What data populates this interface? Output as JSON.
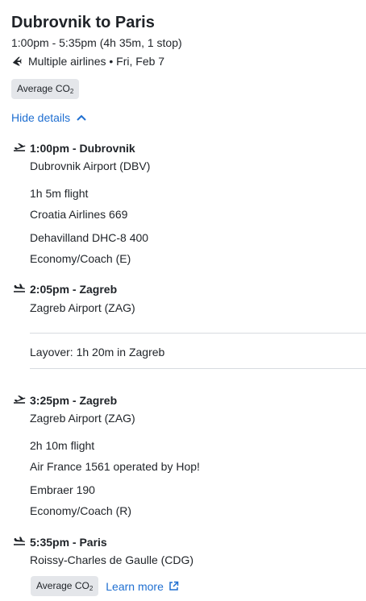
{
  "header": {
    "title": "Dubrovnik to Paris",
    "times": "1:00pm - 5:35pm (4h 35m, 1 stop)",
    "airline_summary": "Multiple airlines • Fri, Feb 7",
    "co2_badge": "Average CO",
    "co2_sub": "2"
  },
  "details_toggle": {
    "label": "Hide details",
    "icon": "chevron-up-icon"
  },
  "segments": [
    {
      "depart": {
        "title": "1:00pm - Dubrovnik",
        "airport": "Dubrovnik Airport (DBV)",
        "icon": "takeoff-icon"
      },
      "duration": "1h 5m flight",
      "flight": "Croatia Airlines 669",
      "aircraft": "Dehavilland DHC-8 400",
      "cabin": "Economy/Coach (E)",
      "arrive": {
        "title": "2:05pm - Zagreb",
        "airport": "Zagreb Airport (ZAG)",
        "icon": "landing-icon"
      }
    },
    {
      "depart": {
        "title": "3:25pm - Zagreb",
        "airport": "Zagreb Airport (ZAG)",
        "icon": "takeoff-icon"
      },
      "duration": "2h 10m flight",
      "flight": "Air France 1561 operated by Hop!",
      "aircraft": "Embraer 190",
      "cabin": "Economy/Coach (R)",
      "arrive": {
        "title": "5:35pm - Paris",
        "airport": "Roissy-Charles de Gaulle (CDG)",
        "icon": "landing-icon"
      }
    }
  ],
  "layover": "Layover: 1h 20m in Zagreb",
  "footer": {
    "co2_badge": "Average CO",
    "co2_sub": "2",
    "learn_more": "Learn more",
    "learn_more_icon": "external-link-icon"
  },
  "colors": {
    "link": "#1f6fd1",
    "badge_bg": "#e4e6ea",
    "divider": "#d7dbe0",
    "text": "#1f2328"
  }
}
